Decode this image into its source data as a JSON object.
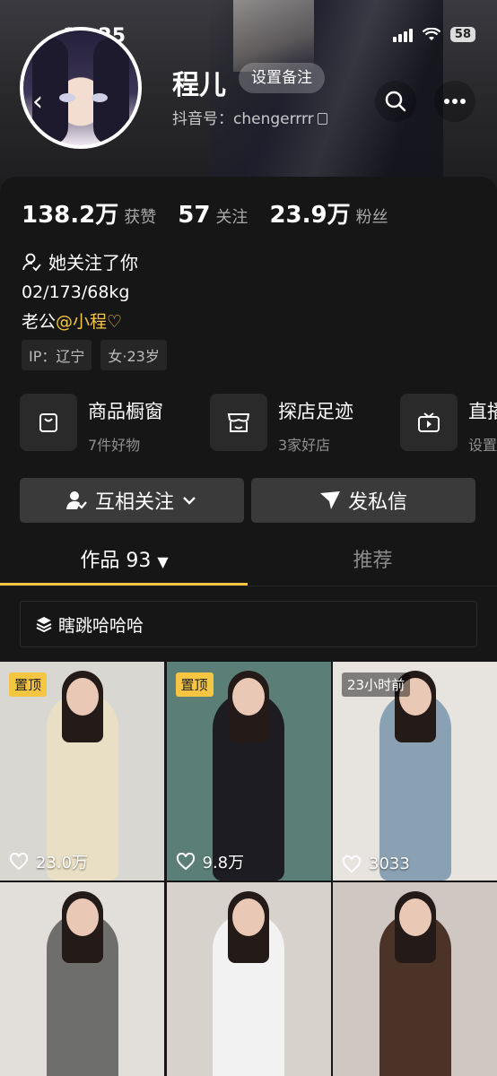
{
  "status_bar": {
    "time": "12:25",
    "battery": "58"
  },
  "header": {
    "nickname": "程儿",
    "remark_button": "设置备注",
    "douyin_id": "抖音号：chengerrrr"
  },
  "stats": [
    {
      "value": "138.2万",
      "label": "获赞"
    },
    {
      "value": "57",
      "label": "关注"
    },
    {
      "value": "23.9万",
      "label": "粉丝"
    }
  ],
  "profile": {
    "follows_you": "她关注了你",
    "bio_line1": "02/173/68kg",
    "bio_line2_prefix": "老公",
    "bio_line2_mention": "@小程♡",
    "tags": [
      "IP：辽宁",
      "女·23岁"
    ]
  },
  "features": [
    {
      "icon": "shopping-bag-icon",
      "title": "商品橱窗",
      "subtitle": "7件好物"
    },
    {
      "icon": "store-icon",
      "title": "探店足迹",
      "subtitle": "3家好店"
    },
    {
      "icon": "tv-icon",
      "title": "直播",
      "subtitle": "设置"
    }
  ],
  "actions": {
    "mutual_follow": "互相关注",
    "message": "发私信"
  },
  "tabs": {
    "works": "作品 93",
    "recommend": "推荐"
  },
  "collection": {
    "label": "瞎跳哈哈哈"
  },
  "videos": [
    {
      "badge": "置顶",
      "badge_type": "pin",
      "likes": "23.0万",
      "bg": "#d9d7d2",
      "outfit": "#e9dfc4"
    },
    {
      "badge": "置顶",
      "badge_type": "pin",
      "likes": "9.8万",
      "bg": "#5b7f76",
      "outfit": "#1c1c22"
    },
    {
      "badge": "23小时前",
      "badge_type": "time",
      "likes": "3033",
      "bg": "#e7e4e0",
      "outfit": "#8aa1b3"
    },
    {
      "badge": "",
      "badge_type": "",
      "likes": "",
      "bg": "#e2dfdb",
      "outfit": "#6e6e6c"
    },
    {
      "badge": "",
      "badge_type": "",
      "likes": "",
      "bg": "#d8d2cc",
      "outfit": "#f2f2f2"
    },
    {
      "badge": "",
      "badge_type": "",
      "likes": "",
      "bg": "#cfc7c1",
      "outfit": "#4b3328"
    }
  ],
  "colors": {
    "accent": "#f6c643",
    "background": "#161616",
    "button": "#3a3a3a"
  }
}
